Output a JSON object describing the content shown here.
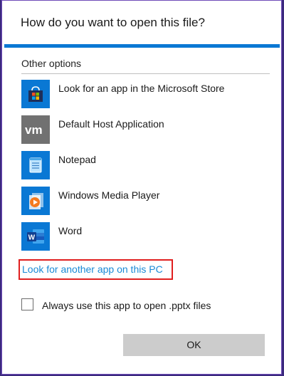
{
  "dialog": {
    "title": "How do you want to open this file?",
    "section_label": "Other options",
    "apps": [
      {
        "label": "Look for an app in the Microsoft Store",
        "icon": "microsoft-store-icon"
      },
      {
        "label": "Default Host Application",
        "icon": "vmware-icon"
      },
      {
        "label": "Notepad",
        "icon": "notepad-icon"
      },
      {
        "label": "Windows Media Player",
        "icon": "windows-media-player-icon"
      },
      {
        "label": "Word",
        "icon": "word-icon"
      }
    ],
    "another_app_link": "Look for another app on this PC",
    "always_use_label": "Always use this app to open .pptx files",
    "always_use_checked": false,
    "ok_label": "OK"
  },
  "colors": {
    "accent": "#0a78d4",
    "link": "#1a8ad6",
    "highlight_border": "#e01f1f",
    "button_bg": "#cccccc"
  }
}
